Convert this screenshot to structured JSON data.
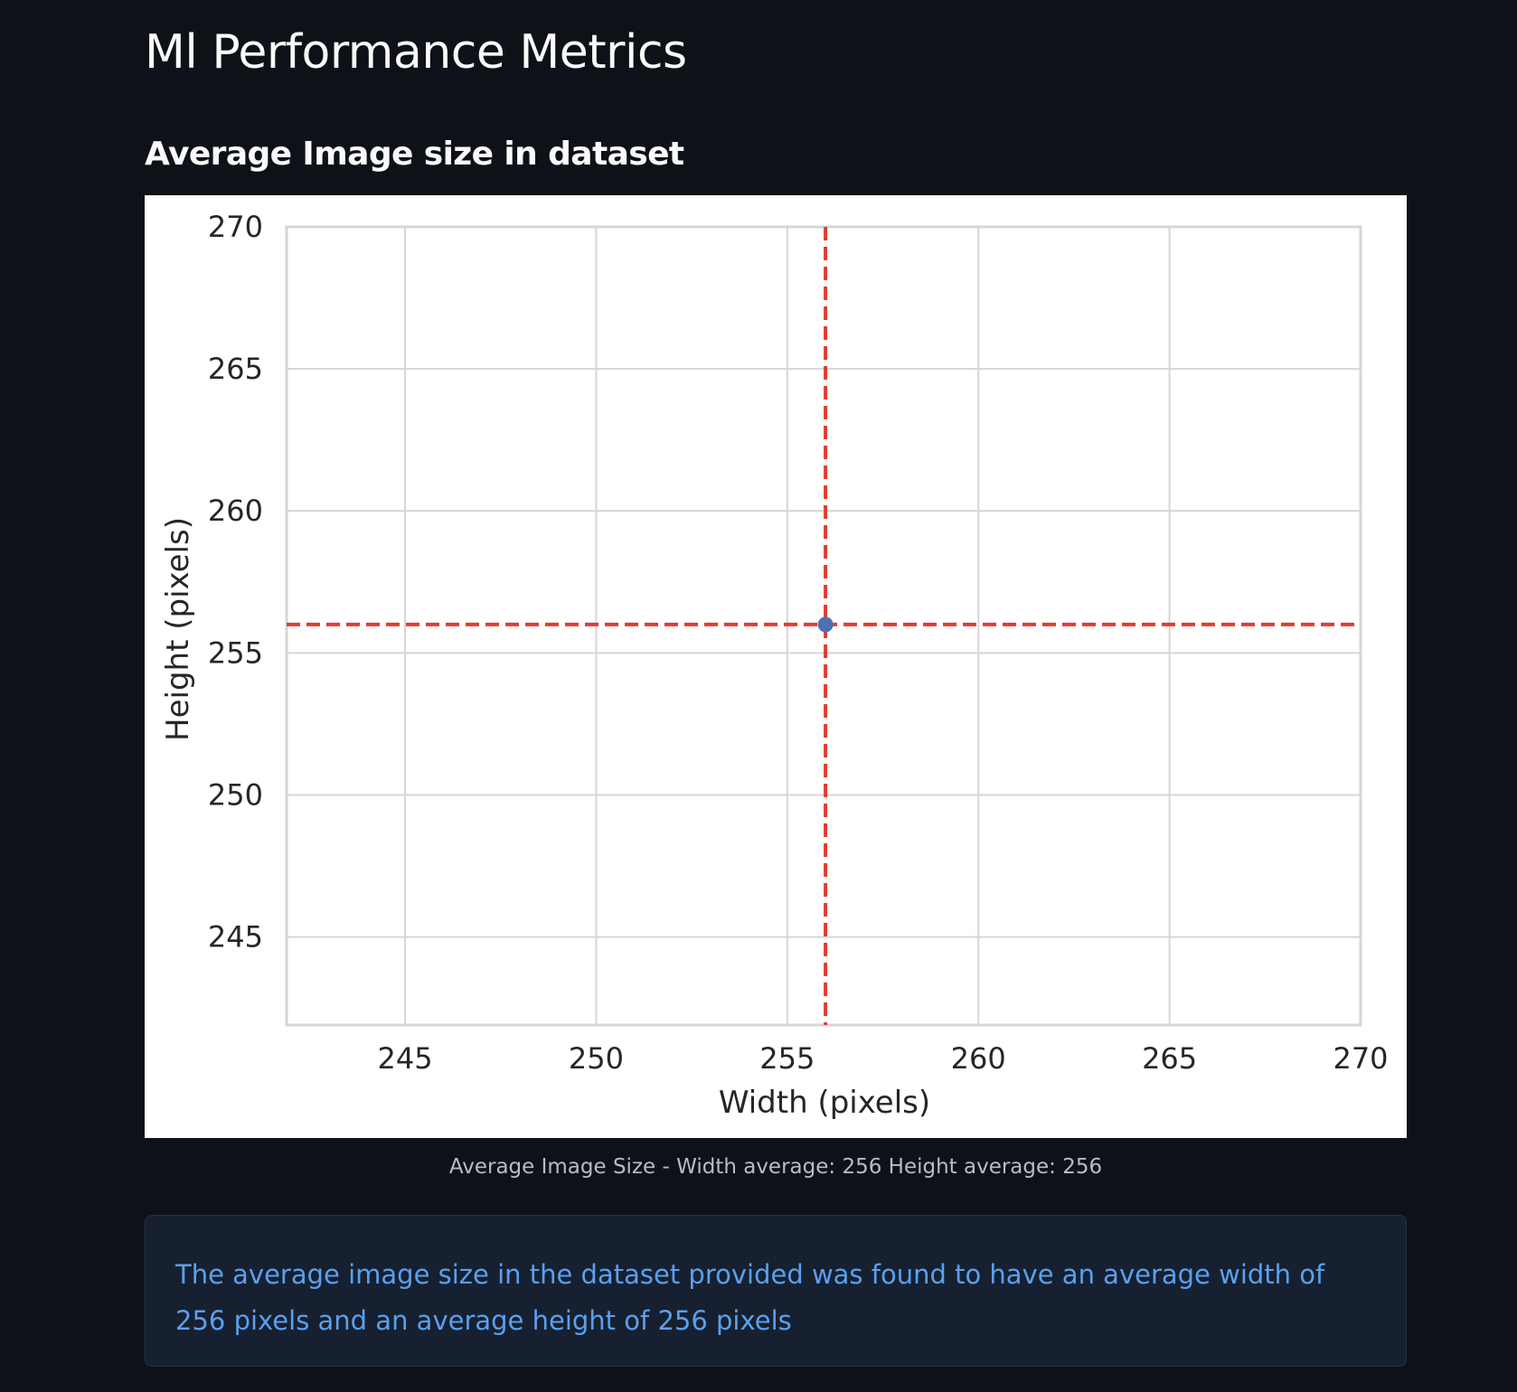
{
  "page": {
    "title": "Ml Performance Metrics",
    "section_title": "Average Image size in dataset",
    "caption": "Average Image Size - Width average: 256 Height average: 256",
    "info_message": "The average image size in the dataset provided was found to have an average width of 256 pixels and an average height of 256 pixels"
  },
  "colors": {
    "background": "#0e1117",
    "text": "#fafafa",
    "caption": "#b9bcc4",
    "info_bg": "#172030",
    "info_text": "#5aa0ee",
    "point": "#4c72b0",
    "reference_line": "#e23b2e",
    "grid": "#d6d6d6"
  },
  "chart_data": {
    "type": "scatter",
    "xlabel": "Width (pixels)",
    "ylabel": "Height (pixels)",
    "xlim": [
      241.9,
      270
    ],
    "ylim": [
      241.9,
      270
    ],
    "x_ticks": [
      245,
      250,
      255,
      260,
      265,
      270
    ],
    "y_ticks": [
      245,
      250,
      255,
      260,
      265,
      270
    ],
    "grid": true,
    "points": [
      {
        "x": 256,
        "y": 256
      }
    ],
    "reference_lines": [
      {
        "orientation": "vertical",
        "value": 256,
        "style": "dashed",
        "color": "#e23b2e"
      },
      {
        "orientation": "horizontal",
        "value": 256,
        "style": "dashed",
        "color": "#e23b2e"
      }
    ]
  }
}
